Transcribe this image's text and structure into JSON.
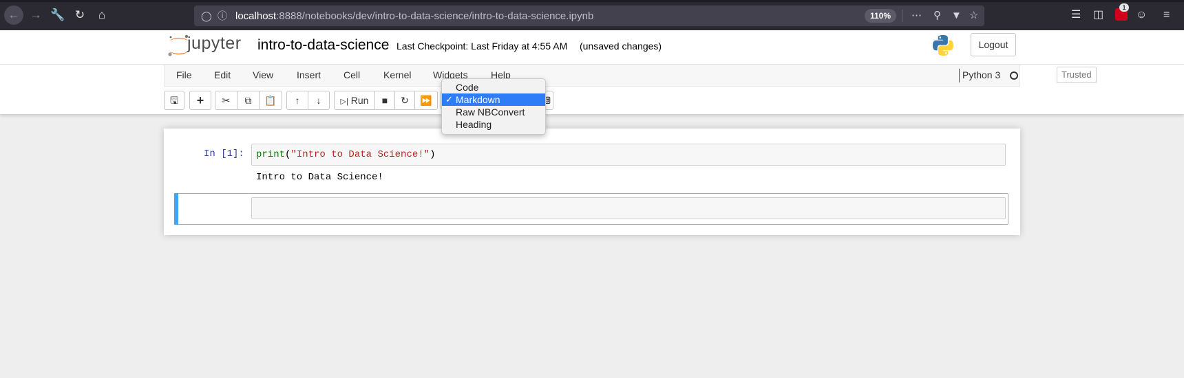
{
  "browser": {
    "url_host": "localhost",
    "url_path": ":8888/notebooks/dev/intro-to-data-science/intro-to-data-science.ipynb",
    "zoom": "110%",
    "badge_count": "1"
  },
  "header": {
    "logo_text": "jupyter",
    "notebook_title": "intro-to-data-science",
    "checkpoint": "Last Checkpoint: Last Friday at 4:55 AM",
    "unsaved": "(unsaved changes)",
    "logout_label": "Logout"
  },
  "menubar": {
    "items": [
      "File",
      "Edit",
      "View",
      "Insert",
      "Cell",
      "Kernel",
      "Widgets",
      "Help"
    ],
    "trusted_label": "Trusted",
    "kernel_name": "Python 3"
  },
  "toolbar": {
    "run_label": "Run"
  },
  "celltype_dropdown": {
    "options": [
      "Code",
      "Markdown",
      "Raw NBConvert",
      "Heading"
    ],
    "selected": "Markdown",
    "check": "✓"
  },
  "cells": {
    "cell1": {
      "prompt": "In [1]:",
      "code_fn": "print",
      "code_open": "(",
      "code_str": "\"Intro to Data Science!\"",
      "code_close": ")",
      "output": "Intro to Data Science!"
    }
  },
  "colors": {
    "selected_cell_bar": "#42a5f5",
    "dropdown_highlight": "#2e7cf6",
    "prompt_in": "#303f9f"
  }
}
